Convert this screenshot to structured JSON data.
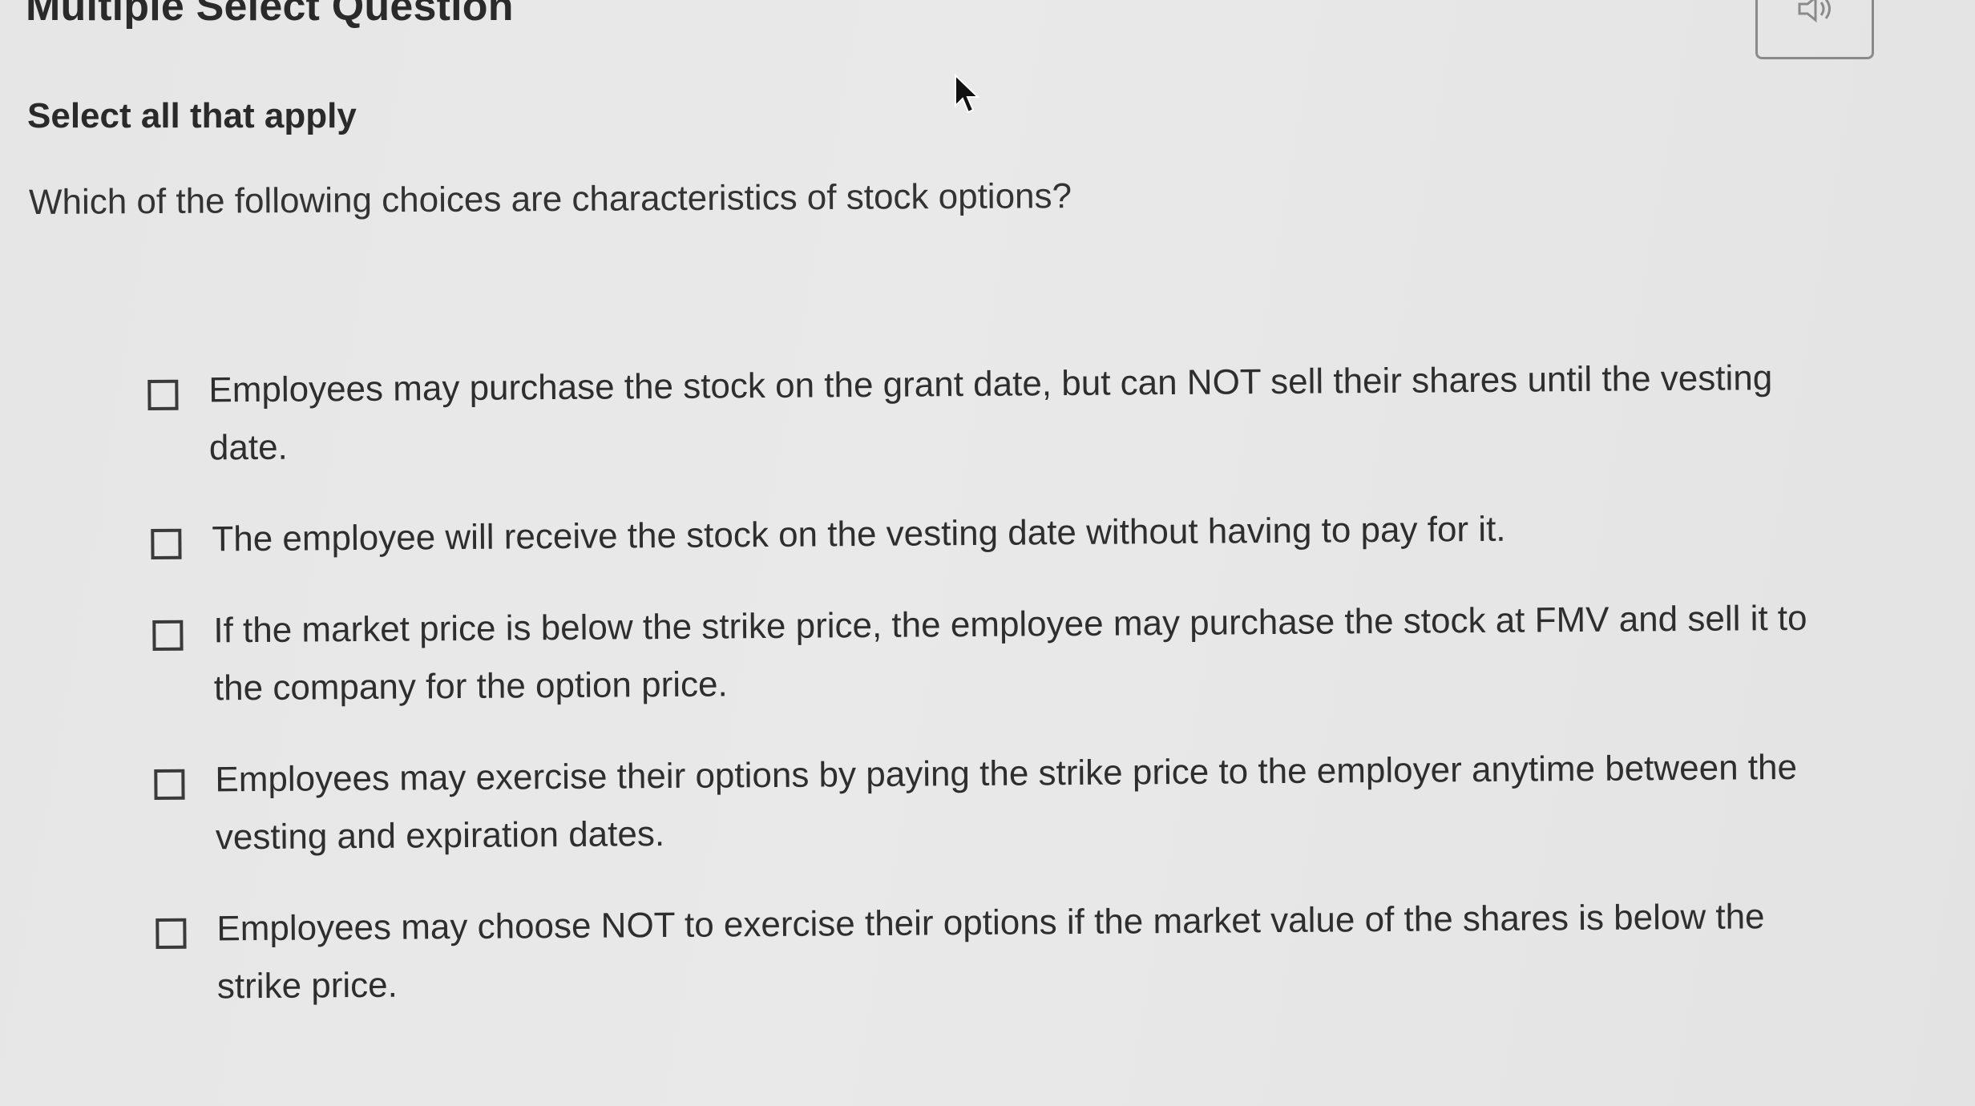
{
  "header": {
    "question_type": "Multiple Select Question",
    "audio_icon": "speaker-icon"
  },
  "question": {
    "instruction": "Select all that apply",
    "prompt": "Which of the following choices are characteristics of stock options?"
  },
  "options": [
    {
      "label": "Employees may purchase the stock on the grant date, but can NOT sell their shares until the vesting date.",
      "checked": false
    },
    {
      "label": "The employee will receive the stock on the vesting date without having to pay for it.",
      "checked": false
    },
    {
      "label": "If the market price is below the strike price, the employee may purchase the stock at FMV and sell it to the company for the option price.",
      "checked": false
    },
    {
      "label": "Employees may exercise their options by paying the strike price to the employer anytime between the vesting and expiration dates.",
      "checked": false
    },
    {
      "label": "Employees may choose NOT to exercise their options if the market value of the shares is below the strike price.",
      "checked": false
    }
  ]
}
